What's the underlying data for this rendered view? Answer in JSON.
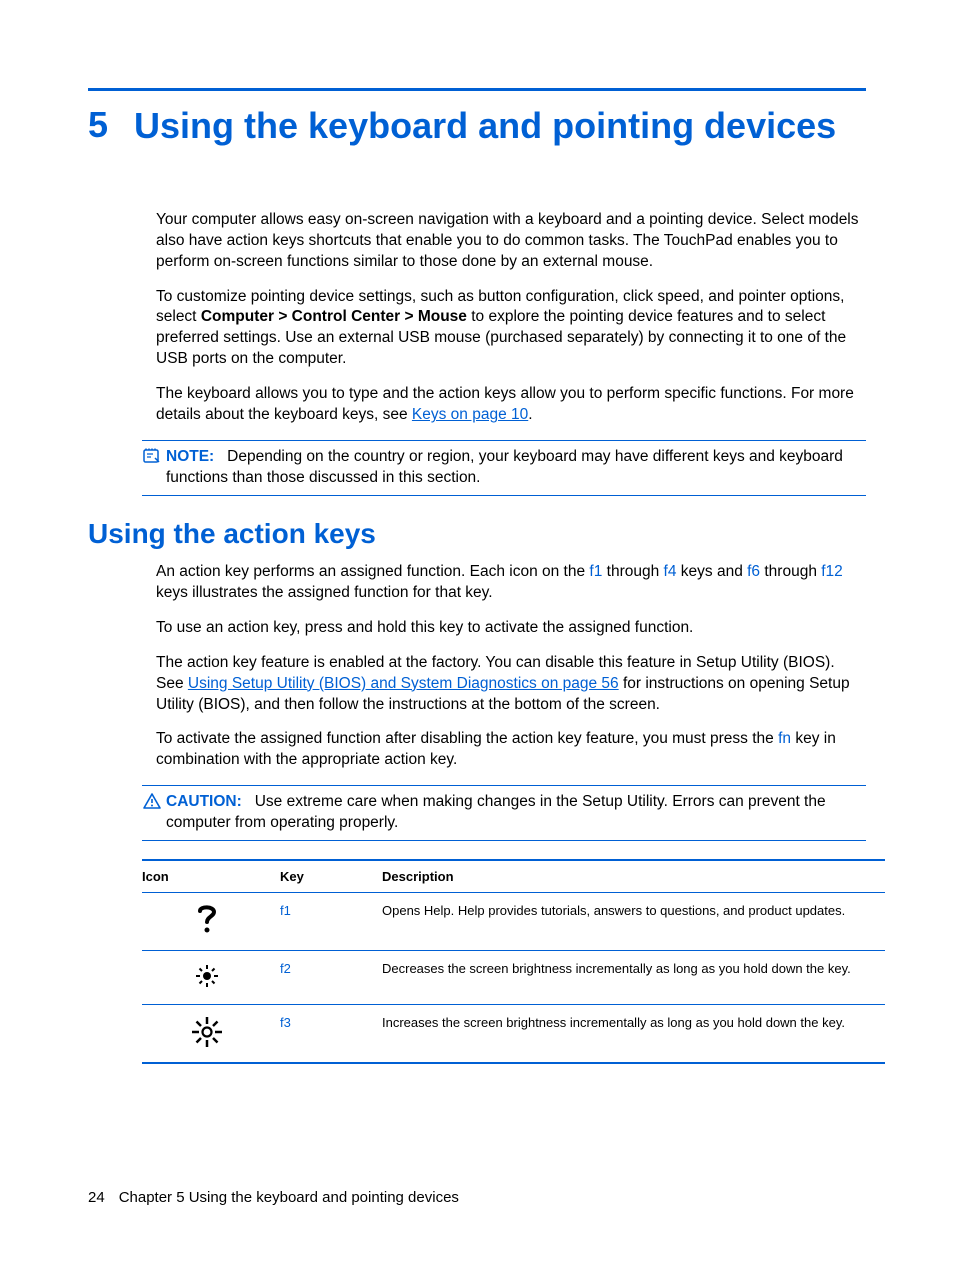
{
  "chapter": {
    "number": "5",
    "title": "Using the keyboard and pointing devices"
  },
  "intro": {
    "p1": "Your computer allows easy on-screen navigation with a keyboard and a pointing device. Select models also have action keys shortcuts that enable you to do common tasks. The TouchPad enables you to perform on-screen functions similar to those done by an external mouse.",
    "p2a": "To customize pointing device settings, such as button configuration, click speed, and pointer options, select ",
    "p2bold": "Computer > Control Center > Mouse",
    "p2b": " to explore the pointing device features and to select preferred settings. Use an external USB mouse (purchased separately) by connecting it to one of the USB ports on the computer.",
    "p3a": "The keyboard allows you to type and the action keys allow you to perform specific functions. For more details about the keyboard keys, see ",
    "p3link": "Keys on page 10",
    "p3b": "."
  },
  "note": {
    "label": "NOTE:",
    "text": "Depending on the country or region, your keyboard may have different keys and keyboard functions than those discussed in this section."
  },
  "section": {
    "heading": "Using the action keys",
    "p1a": "An action key performs an assigned function. Each icon on the ",
    "k_f1": "f1",
    "p1b": " through ",
    "k_f4": "f4",
    "p1c": " keys and ",
    "k_f6": "f6",
    "p1d": " through ",
    "k_f12": "f12",
    "p1e": " keys illustrates the assigned function for that key.",
    "p2": "To use an action key, press and hold this key to activate the assigned function.",
    "p3a": "The action key feature is enabled at the factory. You can disable this feature in Setup Utility (BIOS). See ",
    "p3link": "Using Setup Utility (BIOS) and System Diagnostics on page 56",
    "p3b": " for instructions on opening Setup Utility (BIOS), and then follow the instructions at the bottom of the screen.",
    "p4a": "To activate the assigned function after disabling the action key feature, you must press the ",
    "k_fn": "fn",
    "p4b": " key in combination with the appropriate action key."
  },
  "caution": {
    "label": "CAUTION:",
    "text": "Use extreme care when making changes in the Setup Utility. Errors can prevent the computer from operating properly."
  },
  "table": {
    "headers": {
      "icon": "Icon",
      "key": "Key",
      "desc": "Description"
    },
    "rows": [
      {
        "key": "f1",
        "desc": "Opens Help. Help provides tutorials, answers to questions, and product updates."
      },
      {
        "key": "f2",
        "desc": "Decreases the screen brightness incrementally as long as you hold down the key."
      },
      {
        "key": "f3",
        "desc": "Increases the screen brightness incrementally as long as you hold down the key."
      }
    ]
  },
  "footer": {
    "pagenum": "24",
    "text": "Chapter 5   Using the keyboard and pointing devices"
  }
}
